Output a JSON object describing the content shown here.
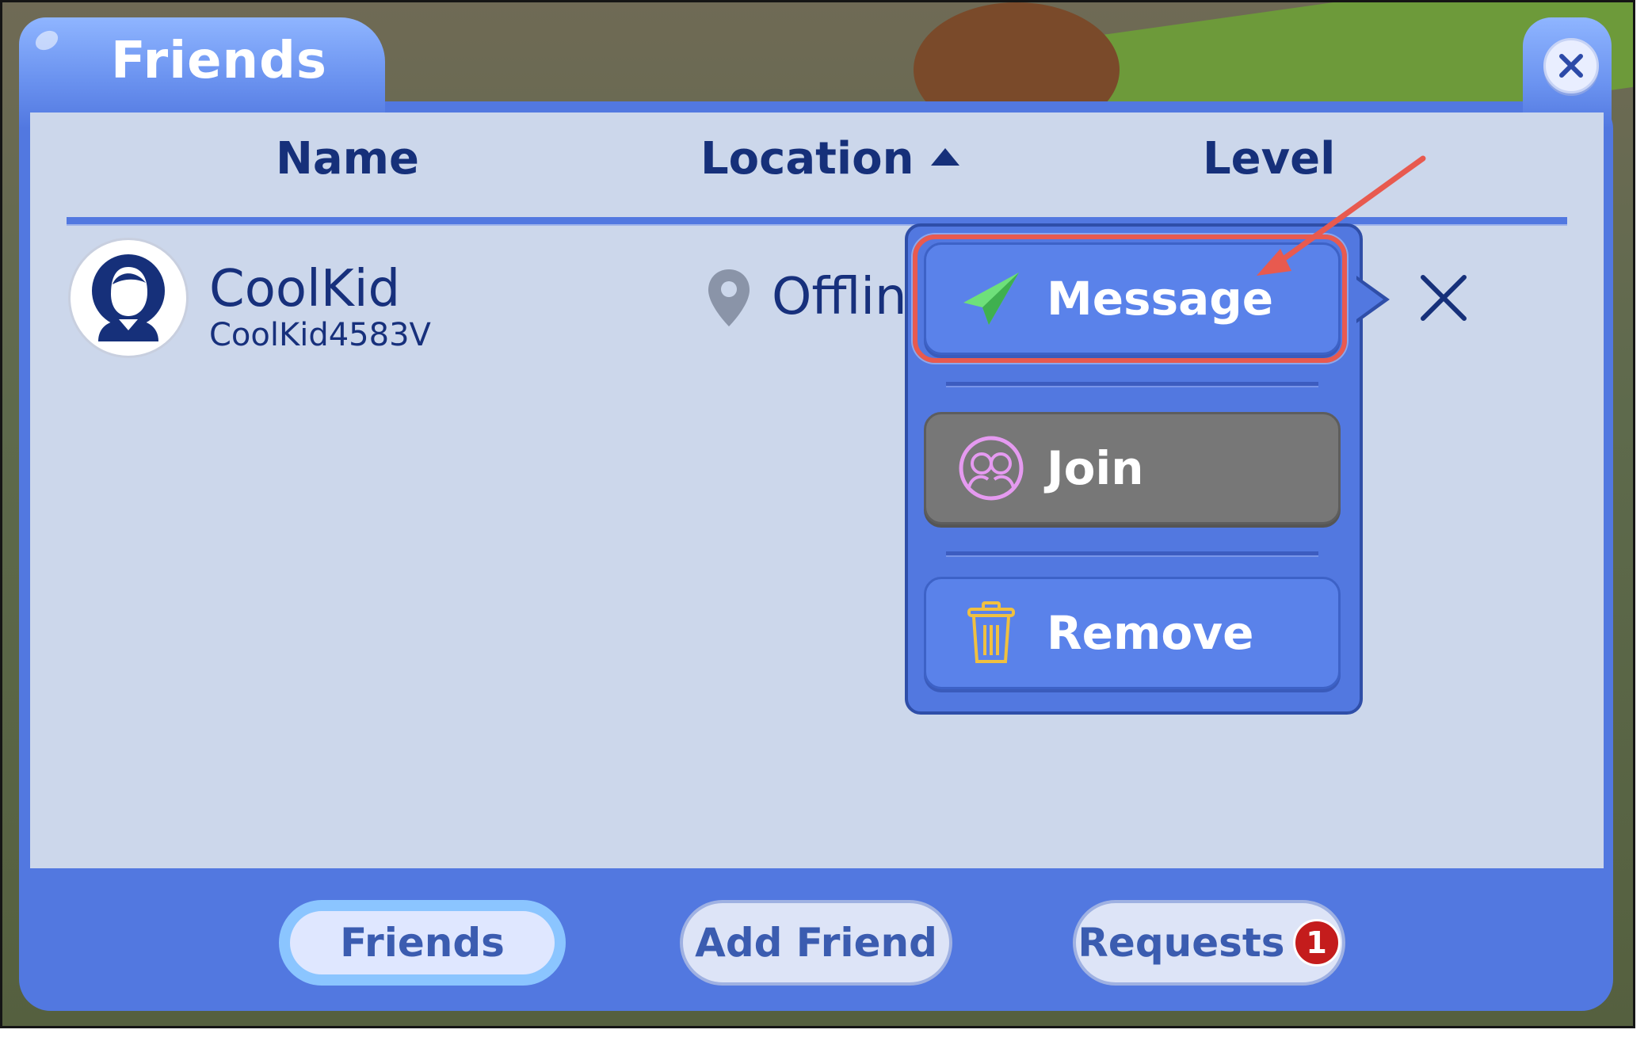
{
  "window": {
    "title": "Friends"
  },
  "columns": [
    {
      "label": "Name"
    },
    {
      "label": "Location",
      "sorted": "ascending"
    },
    {
      "label": "Level"
    }
  ],
  "friends": [
    {
      "display_name": "CoolKid",
      "username": "CoolKid4583V",
      "location": "Offline"
    }
  ],
  "context_menu": {
    "items": [
      {
        "label": "Message",
        "icon": "paper-plane-icon",
        "enabled": true,
        "highlighted": true
      },
      {
        "label": "Join",
        "icon": "friends-join-icon",
        "enabled": false
      },
      {
        "label": "Remove",
        "icon": "trash-icon",
        "enabled": true
      }
    ]
  },
  "bottom_tabs": [
    {
      "label": "Friends",
      "active": true
    },
    {
      "label": "Add Friend",
      "active": false
    },
    {
      "label": "Requests",
      "active": false,
      "badge": "1"
    }
  ],
  "colors": {
    "panel": "#5278e0",
    "content": "#ccd7eb",
    "header_text": "#16307a",
    "annotation": "#e85a4f",
    "badge": "#c41c1c"
  }
}
